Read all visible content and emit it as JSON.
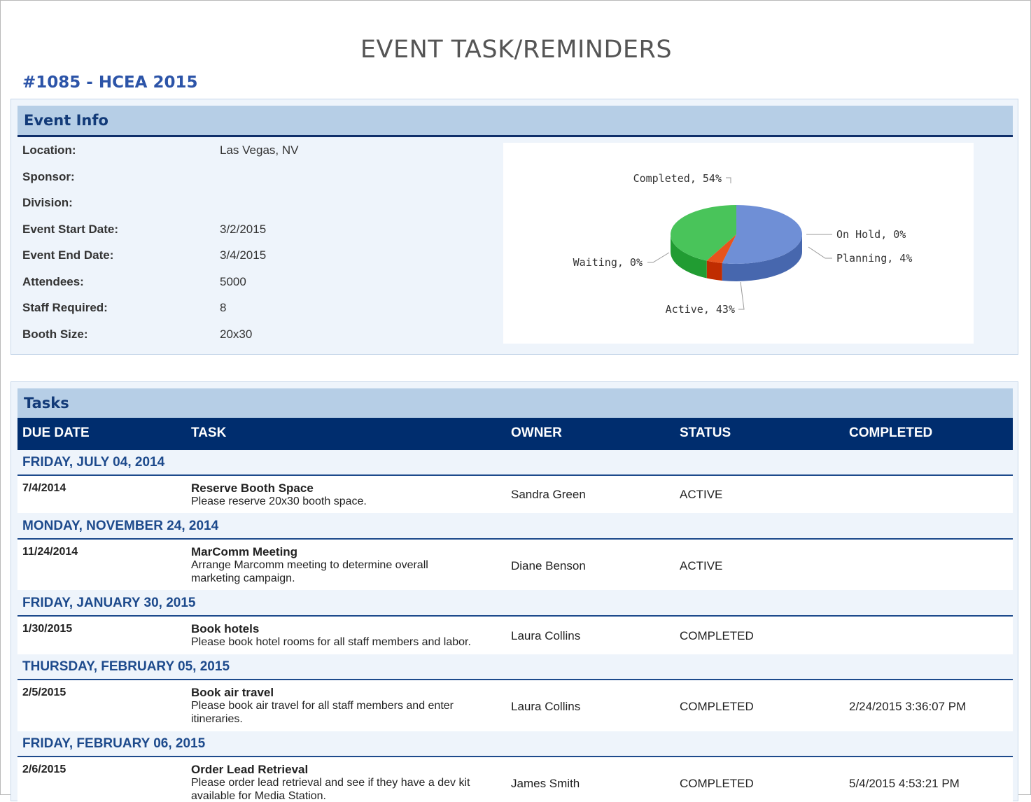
{
  "page_title": "EVENT TASK/REMINDERS",
  "event_title": "#1085 - HCEA 2015",
  "event_info": {
    "header": "Event Info",
    "fields": [
      {
        "label": "Location:",
        "value": "Las Vegas, NV"
      },
      {
        "label": "Sponsor:",
        "value": ""
      },
      {
        "label": "Division:",
        "value": ""
      },
      {
        "label": "Event Start Date:",
        "value": "3/2/2015"
      },
      {
        "label": "Event End Date:",
        "value": "3/4/2015"
      },
      {
        "label": "Attendees:",
        "value": "5000"
      },
      {
        "label": "Staff Required:",
        "value": "8"
      },
      {
        "label": "Booth Size:",
        "value": "20x30"
      }
    ]
  },
  "chart_data": {
    "type": "pie",
    "slices": [
      {
        "label": "Completed, 54%",
        "value": 54,
        "color": "#6f8fd6"
      },
      {
        "label": "On Hold, 0%",
        "value": 0,
        "color": "#e8734a"
      },
      {
        "label": "Planning, 4%",
        "value": 4,
        "color": "#e8541c"
      },
      {
        "label": "Active, 43%",
        "value": 43,
        "color": "#49c45a"
      },
      {
        "label": "Waiting, 0%",
        "value": 0,
        "color": "#cccccc"
      }
    ]
  },
  "tasks": {
    "header": "Tasks",
    "columns": {
      "due_date": "DUE DATE",
      "task": "TASK",
      "owner": "OWNER",
      "status": "STATUS",
      "completed": "COMPLETED"
    },
    "groups": [
      {
        "heading": "FRIDAY, JULY 04, 2014",
        "date": "7/4/2014",
        "title": "Reserve Booth Space",
        "desc": "Please reserve 20x30 booth space.",
        "owner": "Sandra Green",
        "status": "ACTIVE",
        "completed": ""
      },
      {
        "heading": "MONDAY, NOVEMBER 24, 2014",
        "date": "11/24/2014",
        "title": "MarComm Meeting",
        "desc": "Arrange Marcomm meeting to determine overall marketing campaign.",
        "owner": "Diane Benson",
        "status": "ACTIVE",
        "completed": ""
      },
      {
        "heading": "FRIDAY, JANUARY 30, 2015",
        "date": "1/30/2015",
        "title": "Book hotels",
        "desc": "Please book hotel rooms for all staff members and labor.",
        "owner": "Laura Collins",
        "status": "COMPLETED",
        "completed": ""
      },
      {
        "heading": "THURSDAY, FEBRUARY 05, 2015",
        "date": "2/5/2015",
        "title": "Book air travel",
        "desc": "Please book air travel for all staff members and enter itineraries.",
        "owner": "Laura Collins",
        "status": "COMPLETED",
        "completed": "2/24/2015 3:36:07 PM"
      },
      {
        "heading": "FRIDAY, FEBRUARY 06, 2015",
        "date": "2/6/2015",
        "title": "Order Lead Retrieval",
        "desc": "Please order lead retrieval and see if they have a dev kit available for Media Station.",
        "owner": "James Smith",
        "status": "COMPLETED",
        "completed": "5/4/2015 4:53:21 PM"
      }
    ]
  }
}
